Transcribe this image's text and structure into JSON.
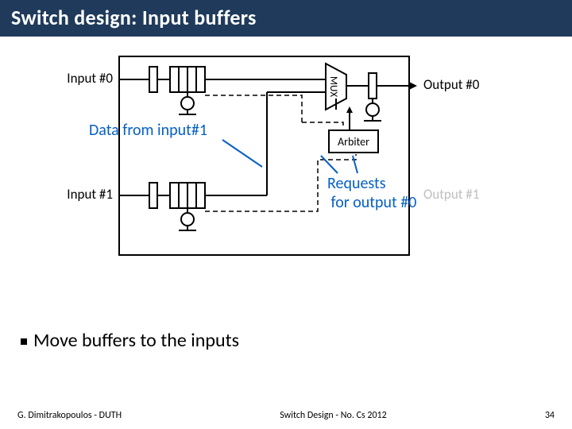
{
  "slide": {
    "title": "Switch design: Input buffers",
    "bullet1": "Move buffers to the inputs",
    "footer_left": "G. Dimitrakopoulos - DUTH",
    "footer_center": "Switch Design - No. Cs 2012",
    "footer_right": "34"
  },
  "annotations": {
    "data_from": "Data from input#1",
    "requests_line1": "Requests",
    "requests_line2": "for output #0"
  },
  "labels": {
    "input0": "Input #0",
    "input1": "Input #1",
    "output0": "Output #0",
    "output1": "Output #1",
    "mux": "MUX",
    "arbiter": "Arbiter"
  }
}
